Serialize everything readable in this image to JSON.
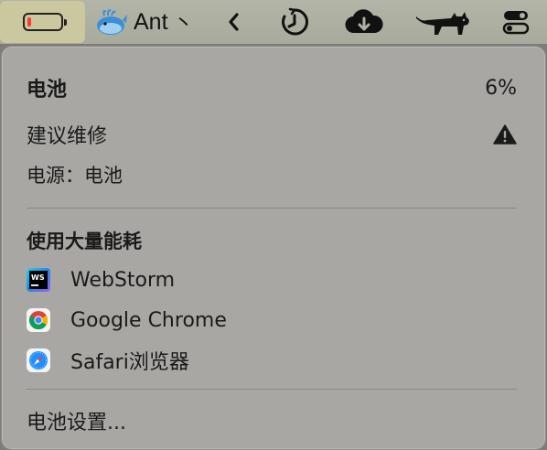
{
  "menubar": {
    "app_name": "Ant",
    "app_suffix": "丶",
    "items": [
      "battery-icon",
      "whale-app-icon",
      "back-chevron-icon",
      "timer-icon",
      "cloud-icon",
      "cat-icon",
      "control-center-icon"
    ]
  },
  "battery_menu": {
    "title": "电池",
    "percent": "6%",
    "service": "建议维修",
    "power_source": "电源：电池",
    "section_heading": "使用大量能耗",
    "apps": [
      {
        "name": "WebStorm",
        "icon": "webstorm-icon"
      },
      {
        "name": "Google Chrome",
        "icon": "chrome-icon"
      },
      {
        "name": "Safari浏览器",
        "icon": "safari-icon"
      }
    ],
    "settings": "电池设置..."
  },
  "colors": {
    "battery_low": "#ff3b30",
    "menubar_bg": "#adb0a2",
    "popover_bg": "#a8a7a3"
  }
}
